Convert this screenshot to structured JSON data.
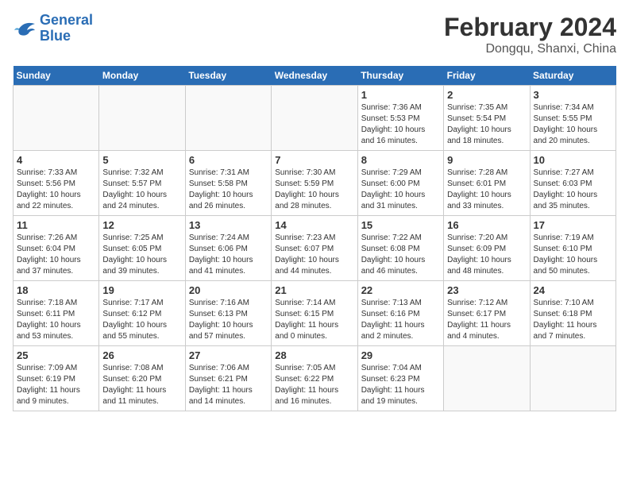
{
  "header": {
    "logo_line1": "General",
    "logo_line2": "Blue",
    "month_year": "February 2024",
    "location": "Dongqu, Shanxi, China"
  },
  "weekdays": [
    "Sunday",
    "Monday",
    "Tuesday",
    "Wednesday",
    "Thursday",
    "Friday",
    "Saturday"
  ],
  "weeks": [
    [
      {
        "day": "",
        "info": ""
      },
      {
        "day": "",
        "info": ""
      },
      {
        "day": "",
        "info": ""
      },
      {
        "day": "",
        "info": ""
      },
      {
        "day": "1",
        "info": "Sunrise: 7:36 AM\nSunset: 5:53 PM\nDaylight: 10 hours\nand 16 minutes."
      },
      {
        "day": "2",
        "info": "Sunrise: 7:35 AM\nSunset: 5:54 PM\nDaylight: 10 hours\nand 18 minutes."
      },
      {
        "day": "3",
        "info": "Sunrise: 7:34 AM\nSunset: 5:55 PM\nDaylight: 10 hours\nand 20 minutes."
      }
    ],
    [
      {
        "day": "4",
        "info": "Sunrise: 7:33 AM\nSunset: 5:56 PM\nDaylight: 10 hours\nand 22 minutes."
      },
      {
        "day": "5",
        "info": "Sunrise: 7:32 AM\nSunset: 5:57 PM\nDaylight: 10 hours\nand 24 minutes."
      },
      {
        "day": "6",
        "info": "Sunrise: 7:31 AM\nSunset: 5:58 PM\nDaylight: 10 hours\nand 26 minutes."
      },
      {
        "day": "7",
        "info": "Sunrise: 7:30 AM\nSunset: 5:59 PM\nDaylight: 10 hours\nand 28 minutes."
      },
      {
        "day": "8",
        "info": "Sunrise: 7:29 AM\nSunset: 6:00 PM\nDaylight: 10 hours\nand 31 minutes."
      },
      {
        "day": "9",
        "info": "Sunrise: 7:28 AM\nSunset: 6:01 PM\nDaylight: 10 hours\nand 33 minutes."
      },
      {
        "day": "10",
        "info": "Sunrise: 7:27 AM\nSunset: 6:03 PM\nDaylight: 10 hours\nand 35 minutes."
      }
    ],
    [
      {
        "day": "11",
        "info": "Sunrise: 7:26 AM\nSunset: 6:04 PM\nDaylight: 10 hours\nand 37 minutes."
      },
      {
        "day": "12",
        "info": "Sunrise: 7:25 AM\nSunset: 6:05 PM\nDaylight: 10 hours\nand 39 minutes."
      },
      {
        "day": "13",
        "info": "Sunrise: 7:24 AM\nSunset: 6:06 PM\nDaylight: 10 hours\nand 41 minutes."
      },
      {
        "day": "14",
        "info": "Sunrise: 7:23 AM\nSunset: 6:07 PM\nDaylight: 10 hours\nand 44 minutes."
      },
      {
        "day": "15",
        "info": "Sunrise: 7:22 AM\nSunset: 6:08 PM\nDaylight: 10 hours\nand 46 minutes."
      },
      {
        "day": "16",
        "info": "Sunrise: 7:20 AM\nSunset: 6:09 PM\nDaylight: 10 hours\nand 48 minutes."
      },
      {
        "day": "17",
        "info": "Sunrise: 7:19 AM\nSunset: 6:10 PM\nDaylight: 10 hours\nand 50 minutes."
      }
    ],
    [
      {
        "day": "18",
        "info": "Sunrise: 7:18 AM\nSunset: 6:11 PM\nDaylight: 10 hours\nand 53 minutes."
      },
      {
        "day": "19",
        "info": "Sunrise: 7:17 AM\nSunset: 6:12 PM\nDaylight: 10 hours\nand 55 minutes."
      },
      {
        "day": "20",
        "info": "Sunrise: 7:16 AM\nSunset: 6:13 PM\nDaylight: 10 hours\nand 57 minutes."
      },
      {
        "day": "21",
        "info": "Sunrise: 7:14 AM\nSunset: 6:15 PM\nDaylight: 11 hours\nand 0 minutes."
      },
      {
        "day": "22",
        "info": "Sunrise: 7:13 AM\nSunset: 6:16 PM\nDaylight: 11 hours\nand 2 minutes."
      },
      {
        "day": "23",
        "info": "Sunrise: 7:12 AM\nSunset: 6:17 PM\nDaylight: 11 hours\nand 4 minutes."
      },
      {
        "day": "24",
        "info": "Sunrise: 7:10 AM\nSunset: 6:18 PM\nDaylight: 11 hours\nand 7 minutes."
      }
    ],
    [
      {
        "day": "25",
        "info": "Sunrise: 7:09 AM\nSunset: 6:19 PM\nDaylight: 11 hours\nand 9 minutes."
      },
      {
        "day": "26",
        "info": "Sunrise: 7:08 AM\nSunset: 6:20 PM\nDaylight: 11 hours\nand 11 minutes."
      },
      {
        "day": "27",
        "info": "Sunrise: 7:06 AM\nSunset: 6:21 PM\nDaylight: 11 hours\nand 14 minutes."
      },
      {
        "day": "28",
        "info": "Sunrise: 7:05 AM\nSunset: 6:22 PM\nDaylight: 11 hours\nand 16 minutes."
      },
      {
        "day": "29",
        "info": "Sunrise: 7:04 AM\nSunset: 6:23 PM\nDaylight: 11 hours\nand 19 minutes."
      },
      {
        "day": "",
        "info": ""
      },
      {
        "day": "",
        "info": ""
      }
    ]
  ]
}
